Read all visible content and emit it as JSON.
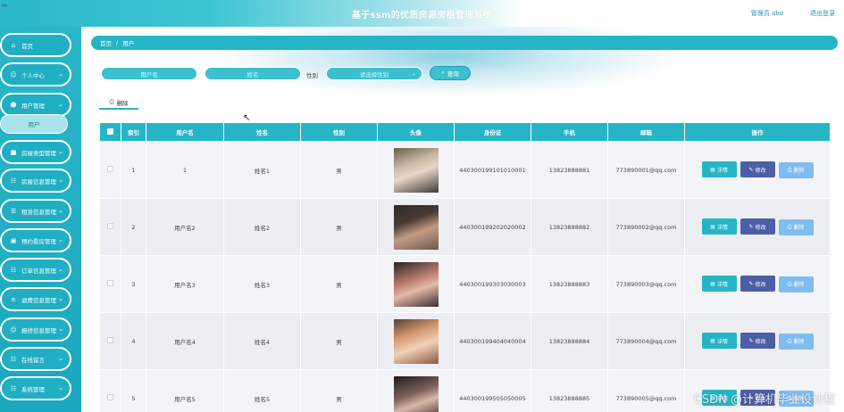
{
  "header": {
    "logo_glyph": "✂",
    "title": "基于ssm的优质房源房租管理系统",
    "user_label": "管理员 abo",
    "logout_label": "退出登录"
  },
  "sidebar": {
    "items": [
      {
        "label": "首页",
        "icon": "home-icon",
        "glyph": "⌂",
        "arrow": false
      },
      {
        "label": "个人中心",
        "icon": "person-icon",
        "glyph": "☺",
        "arrow": true
      },
      {
        "label": "用户管理",
        "icon": "user-group-icon",
        "glyph": "☻",
        "arrow": true
      },
      {
        "label": "房屋类型管理",
        "icon": "chat-icon",
        "glyph": "■",
        "arrow": true
      },
      {
        "label": "房屋信息管理",
        "icon": "grid-icon",
        "glyph": "☷",
        "arrow": true
      },
      {
        "label": "租赁信息管理",
        "icon": "list-icon",
        "glyph": "☰",
        "arrow": true
      },
      {
        "label": "预约看房管理",
        "icon": "calendar-icon",
        "glyph": "▣",
        "arrow": true
      },
      {
        "label": "订单信息管理",
        "icon": "grid-icon",
        "glyph": "☷",
        "arrow": true
      },
      {
        "label": "退费信息管理",
        "icon": "menu-icon",
        "glyph": "≡",
        "arrow": true
      },
      {
        "label": "报修信息管理",
        "icon": "person-icon",
        "glyph": "☺",
        "arrow": true
      },
      {
        "label": "在线留言",
        "icon": "grid-icon",
        "glyph": "☷",
        "arrow": true
      },
      {
        "label": "系统管理",
        "icon": "grid-icon",
        "glyph": "☷",
        "arrow": true
      }
    ],
    "sub_item": "用户",
    "arrow_glyph": "⌄"
  },
  "breadcrumb": {
    "home": "首页",
    "sep": "/",
    "current": "用户"
  },
  "search": {
    "username_placeholder": "用户名",
    "name_placeholder": "姓名",
    "gender_label": "性别",
    "gender_placeholder": "请选择性别",
    "select_arrow": "⌄",
    "query_icon_glyph": "⌕",
    "query_label": "查询"
  },
  "toolbar": {
    "delete_icon_glyph": "⎙",
    "delete_label": "删除"
  },
  "table": {
    "headers": [
      "",
      "索引",
      "用户名",
      "姓名",
      "性别",
      "头像",
      "身份证",
      "手机",
      "邮箱",
      "操作"
    ],
    "rows": [
      {
        "index": "1",
        "username": "1",
        "name": "姓名1",
        "gender": "男",
        "id_card": "440300199101010001",
        "phone": "13823888881",
        "email": "773890001@qq.com"
      },
      {
        "index": "2",
        "username": "用户名2",
        "name": "姓名2",
        "gender": "男",
        "id_card": "440300199202020002",
        "phone": "13823888882",
        "email": "773890002@qq.com"
      },
      {
        "index": "3",
        "username": "用户名3",
        "name": "姓名3",
        "gender": "男",
        "id_card": "440300199303030003",
        "phone": "13823888883",
        "email": "773890003@qq.com"
      },
      {
        "index": "4",
        "username": "用户名4",
        "name": "姓名4",
        "gender": "男",
        "id_card": "440300199404040004",
        "phone": "13823888884",
        "email": "773890004@qq.com"
      },
      {
        "index": "5",
        "username": "用户名5",
        "name": "姓名5",
        "gender": "男",
        "id_card": "440300199505050005",
        "phone": "13823888885",
        "email": "773890005@qq.com"
      }
    ],
    "actions": {
      "detail": "详情",
      "edit": "修改",
      "delete": "删除",
      "detail_glyph": "▤",
      "edit_glyph": "✎",
      "delete_glyph": "⎙"
    }
  },
  "cursor_glyph": "↖",
  "watermark": "CSDN @计算机毕业设计程",
  "colors": {
    "accent": "#26b5c6",
    "edit": "#4b5ea6",
    "delete": "#7fbcf0"
  }
}
